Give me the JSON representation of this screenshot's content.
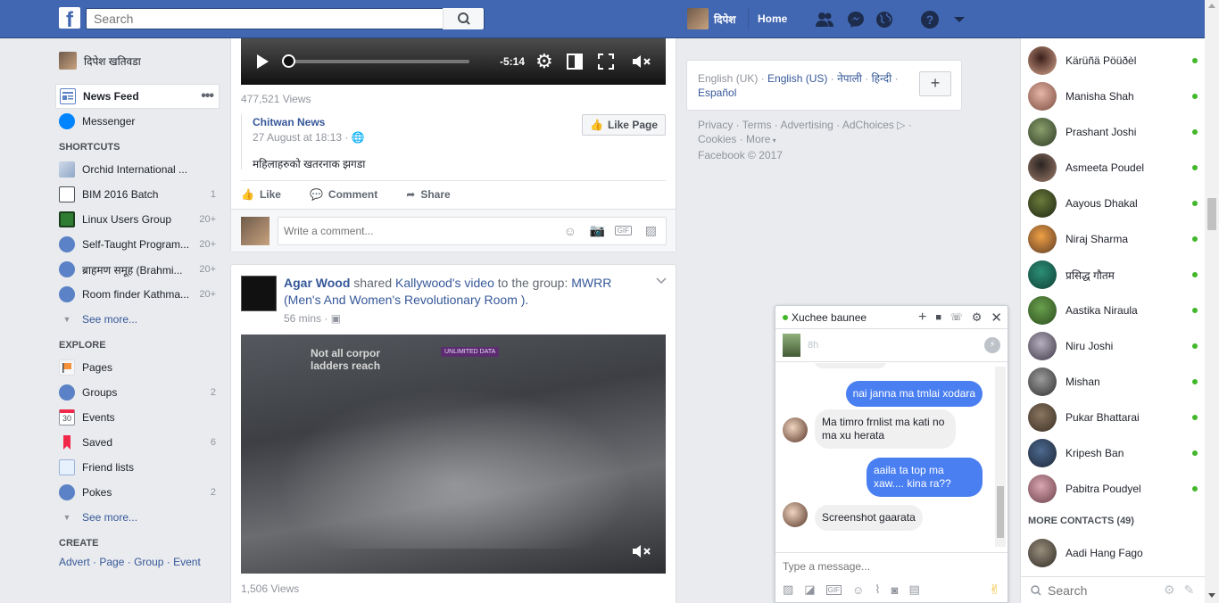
{
  "topbar": {
    "search_placeholder": "Search",
    "profile_name": "दिपेश",
    "home_label": "Home"
  },
  "leftnav": {
    "user_name": "दिपेश खतिवडा",
    "news_feed": "News Feed",
    "messenger": "Messenger",
    "shortcuts_head": "SHORTCUTS",
    "shortcuts": [
      {
        "label": "Orchid International ...",
        "count": ""
      },
      {
        "label": "BIM 2016 Batch",
        "count": "1"
      },
      {
        "label": "Linux Users Group",
        "count": "20+"
      },
      {
        "label": "Self-Taught Program...",
        "count": "20+"
      },
      {
        "label": "ब्राहमण समूह (Brahmi...",
        "count": "20+"
      },
      {
        "label": "Room finder Kathma...",
        "count": "20+"
      }
    ],
    "see_more": "See more...",
    "explore_head": "EXPLORE",
    "explore": [
      {
        "label": "Pages",
        "count": ""
      },
      {
        "label": "Groups",
        "count": "2"
      },
      {
        "label": "Events",
        "count": ""
      },
      {
        "label": "Saved",
        "count": "6"
      },
      {
        "label": "Friend lists",
        "count": ""
      },
      {
        "label": "Pokes",
        "count": "2"
      }
    ],
    "events_icon_text": "30",
    "create_head": "CREATE",
    "create_links": [
      "Advert",
      "Page",
      "Group",
      "Event"
    ]
  },
  "post1": {
    "video_time": "-5:14",
    "views": "477,521 Views",
    "page_name": "Chitwan News",
    "date": "27 August at 18:13 · ",
    "like_page": "Like Page",
    "text": "महिलाहरुको खतरनाक झगडा",
    "like": "Like",
    "comment": "Comment",
    "share": "Share",
    "comment_placeholder": "Write a comment..."
  },
  "post2": {
    "author": "Agar Wood",
    "shared": " shared ",
    "source": "Kallywood",
    "source_suffix": "'s video",
    "to_group": " to the group: ",
    "group": "MWRR (Men's And Women's Revolutionary Room",
    "group_end": ").",
    "time": "56 mins · ",
    "views": "1,506 Views",
    "video_caption1": "Not all corpor",
    "video_caption2": "ladders reach",
    "video_sign": "UNLIMITED DATA"
  },
  "right": {
    "langs": [
      "English (UK)",
      "English (US)",
      "नेपाली",
      "हिन्दी",
      "Español"
    ],
    "footer_line1": [
      "Privacy",
      "Terms",
      "Advertising",
      "AdChoices"
    ],
    "footer_line2": [
      "Cookies",
      "More"
    ],
    "copyright": "Facebook © 2017"
  },
  "contacts": [
    "Kärüñä Pöüðèl",
    "Manisha Shah",
    "Prashant Joshi",
    "Asmeeta Poudel",
    "Aayous Dhakal",
    "Niraj Sharma",
    "प्रसिद्ध गौतम",
    "Aastika Niraula",
    "Niru Joshi",
    "Mishan",
    "Pukar Bhattarai",
    "Kripesh Ban",
    "Pabitra Poudyel"
  ],
  "more_contacts": "MORE CONTACTS (49)",
  "extra_contact": "Aadi Hang Fago",
  "chat_search_placeholder": "Search",
  "chat": {
    "name": "Xuchee baunee",
    "time": "8h",
    "messages": [
      {
        "from": "me",
        "text": "nai janna ma tmlai xodara"
      },
      {
        "from": "them",
        "text": "Ma timro frnlist ma kati no ma xu herata"
      },
      {
        "from": "me",
        "text": "aaila ta top ma xaw.... kina ra??"
      },
      {
        "from": "them",
        "text": "Screenshot gaarata"
      }
    ],
    "input_placeholder": "Type a message..."
  },
  "colors": {
    "brand": "#4267b2",
    "link": "#365899",
    "online": "#42b72a",
    "bubble": "#4a7ff2"
  }
}
